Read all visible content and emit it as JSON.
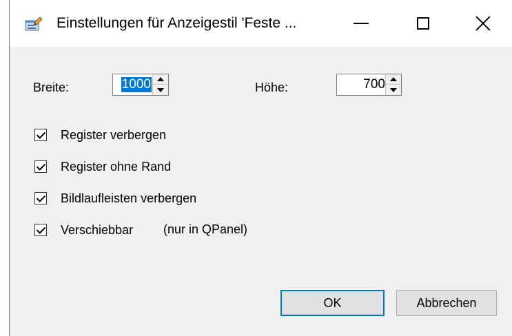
{
  "window": {
    "title": "Einstellungen für Anzeigestil 'Feste ...",
    "app_icon": "settings-form-icon"
  },
  "titlebar_buttons": {
    "minimize": "minimize-icon",
    "maximize": "maximize-icon",
    "close": "close-icon"
  },
  "fields": {
    "width_label": "Breite:",
    "width_value": "1000",
    "height_label": "Höhe:",
    "height_value": "700"
  },
  "checkboxes": [
    {
      "label": "Register verbergen",
      "checked": true
    },
    {
      "label": "Register ohne Rand",
      "checked": true
    },
    {
      "label": "Bildlaufleisten verbergen",
      "checked": true
    },
    {
      "label": "Verschiebbar",
      "checked": true,
      "note": "(nur in QPanel)"
    }
  ],
  "buttons": {
    "ok": "OK",
    "cancel": "Abbrechen"
  },
  "colors": {
    "accent": "#0078d7",
    "dialog_bg": "#f0f0f0"
  }
}
